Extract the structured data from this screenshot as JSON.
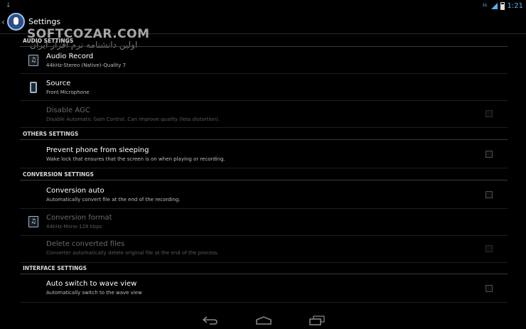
{
  "status_bar": {
    "signal_label": "3G",
    "time": "1:21"
  },
  "action_bar": {
    "title": "Settings"
  },
  "watermark": {
    "brand": "SOFTCOZAR.COM",
    "tagline": "اولین دانشنامه نرم افزار ایران"
  },
  "sections": {
    "audio": "AUDIO SETTINGS",
    "others": "OTHERS SETTINGS",
    "conversion": "CONVERSION SETTINGS",
    "interface": "INTERFACE SETTINGS"
  },
  "prefs": {
    "audio_record": {
      "title": "Audio Record",
      "summary": "44kHz-Stereo (Native)-Quality 7",
      "icon": "music-file-icon"
    },
    "source": {
      "title": "Source",
      "summary": "Front Microphone",
      "icon": "phone-icon"
    },
    "disable_agc": {
      "title": "Disable AGC",
      "summary": "Disable Automatic Gain Control. Can improve quality (less distortion).",
      "checked": false,
      "enabled": false
    },
    "prevent_sleep": {
      "title": "Prevent phone from sleeping",
      "summary": "Wake lock that ensures that the screen is on when playing or recording.",
      "checked": false
    },
    "conversion_auto": {
      "title": "Conversion auto",
      "summary": "Automatically convert file at the end of the recording.",
      "checked": false
    },
    "conversion_format": {
      "title": "Conversion format",
      "summary": "44kHz-Mono-128 kbps",
      "icon": "music-file-icon",
      "enabled": false
    },
    "delete_converted": {
      "title": "Delete converted files",
      "summary": "Converter automatically delete original file at the end of the process.",
      "checked": false,
      "enabled": false
    },
    "auto_wave": {
      "title": "Auto switch to wave view",
      "summary": "Automatically switch to the wave view",
      "checked": false
    }
  },
  "navigation": {
    "buttons": [
      "back",
      "home",
      "recent-apps"
    ]
  }
}
